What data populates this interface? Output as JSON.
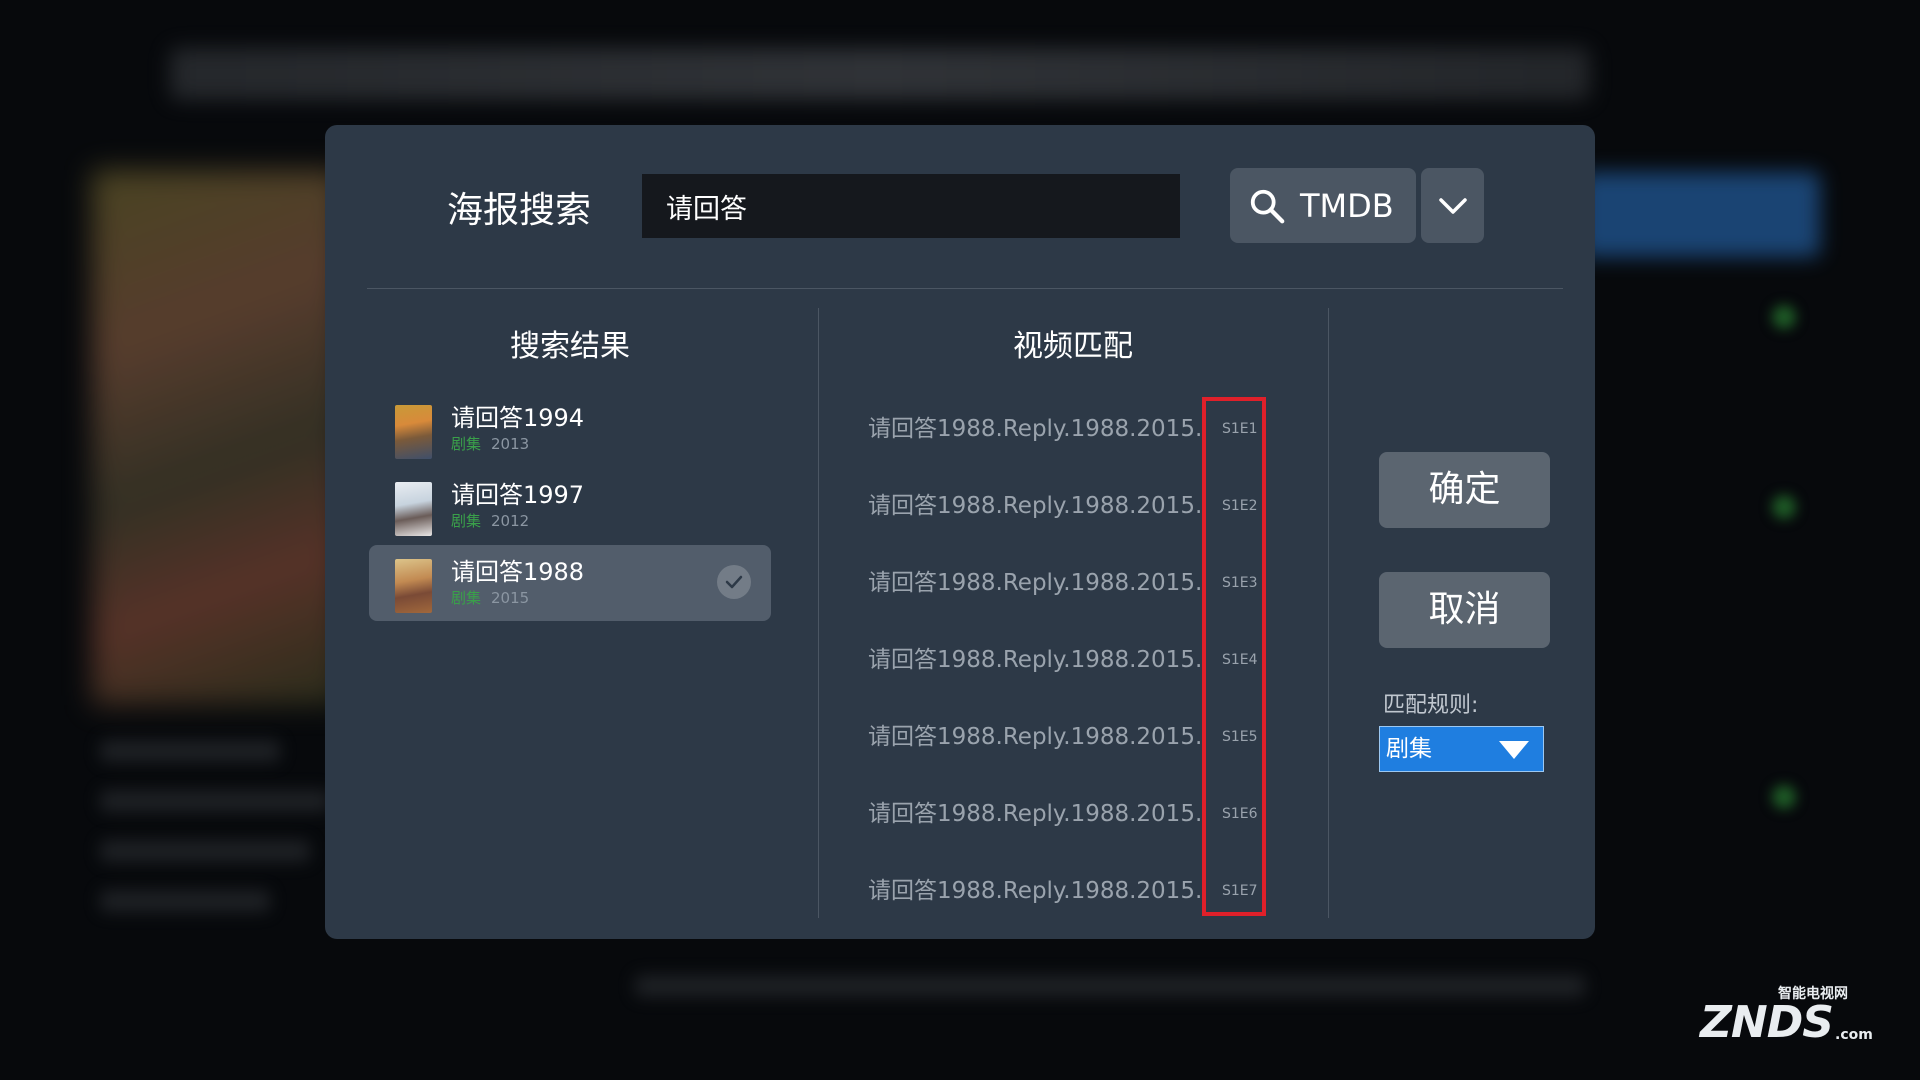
{
  "dialog": {
    "title": "海报搜索",
    "search": {
      "value": "请回答",
      "placeholder": ""
    },
    "source": {
      "label": "TMDB",
      "icon": "search-icon"
    },
    "dropdown_icon": "chevron-down-icon"
  },
  "results": {
    "title": "搜索结果",
    "items": [
      {
        "name": "请回答1994",
        "type": "剧集",
        "year": "2013",
        "selected": false
      },
      {
        "name": "请回答1997",
        "type": "剧集",
        "year": "2012",
        "selected": false
      },
      {
        "name": "请回答1988",
        "type": "剧集",
        "year": "2015",
        "selected": true
      }
    ]
  },
  "match": {
    "title": "视频匹配",
    "rows": [
      {
        "name": "请回答1988.Reply.1988.2015.S..",
        "episode": "S1E1"
      },
      {
        "name": "请回答1988.Reply.1988.2015.S..",
        "episode": "S1E2"
      },
      {
        "name": "请回答1988.Reply.1988.2015.S..",
        "episode": "S1E3"
      },
      {
        "name": "请回答1988.Reply.1988.2015.S..",
        "episode": "S1E4"
      },
      {
        "name": "请回答1988.Reply.1988.2015.S..",
        "episode": "S1E5"
      },
      {
        "name": "请回答1988.Reply.1988.2015.S..",
        "episode": "S1E6"
      },
      {
        "name": "请回答1988.Reply.1988.2015.S..",
        "episode": "S1E7"
      }
    ]
  },
  "actions": {
    "confirm": "确定",
    "cancel": "取消",
    "rule_label": "匹配规则:",
    "rule_value": "剧集"
  },
  "watermark": {
    "main": "ZNDS",
    "sub": "智能电视网",
    "suffix": ".com"
  },
  "colors": {
    "dialog_bg": "#2d3947",
    "selected_bg": "#525d6b",
    "accent_blue": "#1f7ee0",
    "highlight_red": "#e0202a",
    "type_green": "#3aa04a"
  }
}
